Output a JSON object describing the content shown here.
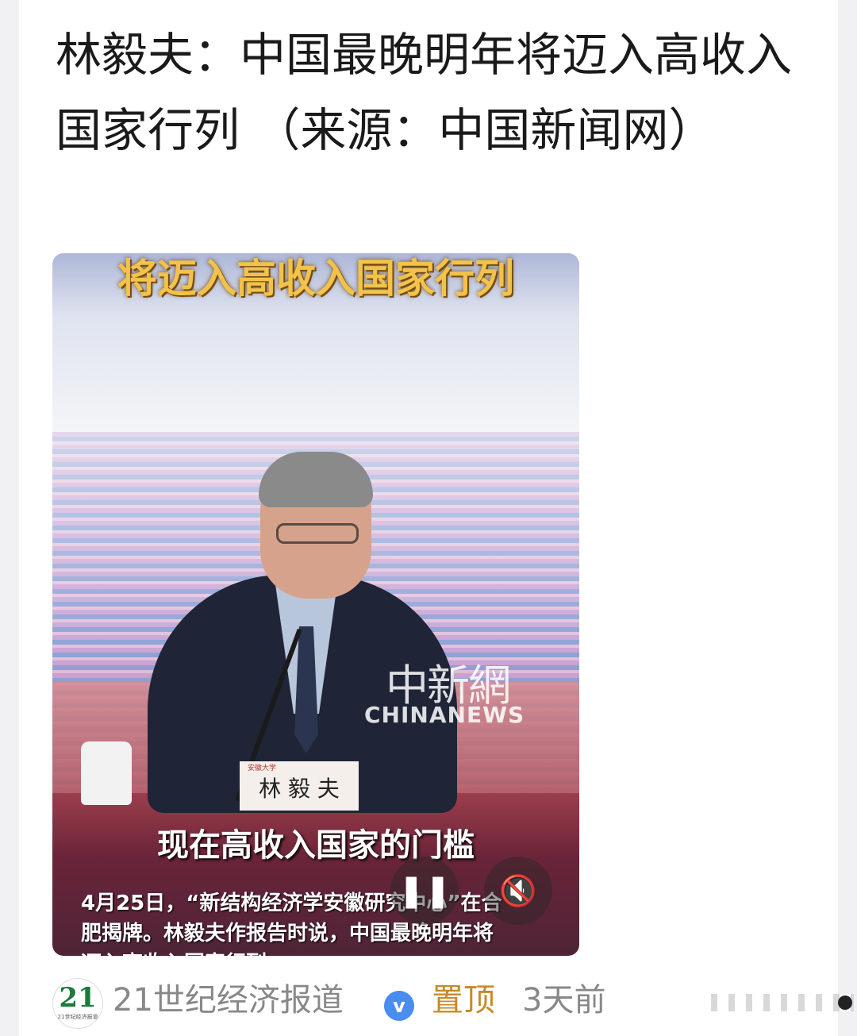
{
  "post": {
    "headline": "林毅夫：中国最晚明年将迈入高收入国家行列 （来源：中国新闻网）"
  },
  "video": {
    "title_overlay": "将迈入高收入国家行列",
    "nameplate": "林 毅 夫",
    "nameplate_org": "安徽大学",
    "watermark_cn": "中新網",
    "watermark_en": "CHINANEWS",
    "subtitle": "现在高收入国家的门槛",
    "caption": "4月25日，“新结构经济学安徽研究中心”在合肥揭牌。林毅夫作报告时说，中国最晚明年将迈入高收入国家行列",
    "pause_icon": "pause-icon",
    "mute_icon": "muted-speaker-icon"
  },
  "footer": {
    "avatar_text": "21",
    "avatar_subtext": "21世纪经济报道",
    "author": "21世纪经济报道",
    "verified_icon": "v",
    "pinned_label": "置顶",
    "time": "3天前"
  },
  "colors": {
    "pinned": "#c7892a",
    "verified": "#4a8df0",
    "title_overlay": "#f3c24a"
  }
}
